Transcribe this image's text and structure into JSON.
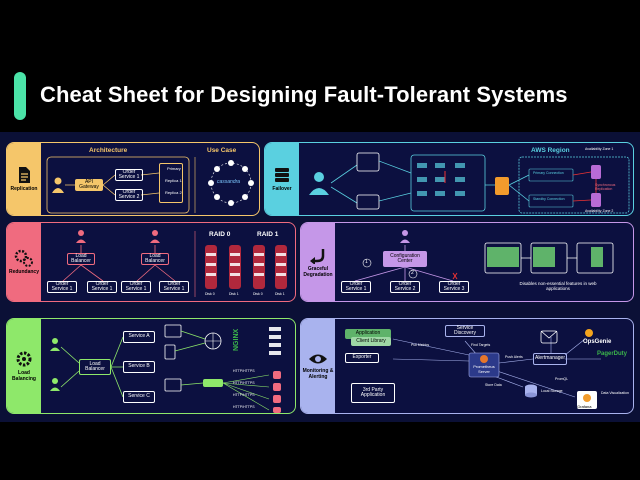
{
  "title": "Cheat Sheet for Designing Fault-Tolerant Systems",
  "replication": {
    "side_label": "Replication",
    "architecture_title": "Architecture",
    "use_case_title": "Use Case",
    "api_gateway": "API Gateway",
    "order_service_1": "Order Service 1",
    "order_service_2": "Order Service 2",
    "primary": "Primary",
    "replica_1": "Replica 1",
    "replica_2": "Replica 2",
    "cassandra": "cassandra"
  },
  "failover": {
    "side_label": "Failover",
    "aws_region": "AWS Region",
    "az1": "Availability Zone 1",
    "az2": "Availability Zone 2",
    "primary_connection": "Primary Connection",
    "standby_connection": "Standby Connection",
    "synchronous_replication": "Synchronous Replication"
  },
  "redundancy": {
    "side_label": "Redundancy",
    "load_balancer": "Load Balancer",
    "order_service_1": "Order Service 1",
    "raid0": "RAID 0",
    "raid1": "RAID 1",
    "disks": [
      "Disk 0",
      "Disk 1",
      "Disk 0",
      "Disk 1"
    ]
  },
  "graceful": {
    "side_label": "Graceful Degradation",
    "configuration_center": "Configuration Center",
    "step1": "1",
    "step2": "2",
    "order_service_1": "Order Service 1",
    "order_service_2": "Order Service 2",
    "order_service_3": "Order Service 3",
    "disables_text": "Disables non-essential features in web applications"
  },
  "load_balancing": {
    "side_label": "Load Balancing",
    "load_balancer": "Load Balancer",
    "service_a": "Service A",
    "service_b": "Service B",
    "service_c": "Service C",
    "nginx": "NGINX",
    "http1": "HTTP/HTTPS",
    "http2": "HTTP/HTTPS",
    "http3": "HTTP/HTTPS",
    "http4": "HTTP/HTTPS"
  },
  "monitoring": {
    "side_label": "Monitoring & Alerting",
    "application": "Application",
    "client_library": "Client Library",
    "exporter": "Exporter",
    "third_party": "3rd Party Application",
    "pull_metrics": "Pull Metrics",
    "service_discovery": "Service Discovery",
    "find_targets": "Find Targets",
    "prometheus_server": "Prometheus Server",
    "push_alerts": "Push Alerts",
    "alertmanager": "Alertmanager",
    "opsgenie": "OpsGenie",
    "pagerduty": "PagerDuty",
    "grafana": "Grafana",
    "promql": "PromQL",
    "store_data": "Store Data",
    "local_storage": "Local Storage",
    "data_visualization": "Data Visualization"
  },
  "colors": {
    "replication": "#f5c66a",
    "failover": "#5ad0e0",
    "redundancy": "#f06b7f",
    "graceful": "#c597e8",
    "load_balancing": "#8ee86a",
    "monitoring": "#a9b3ee"
  }
}
